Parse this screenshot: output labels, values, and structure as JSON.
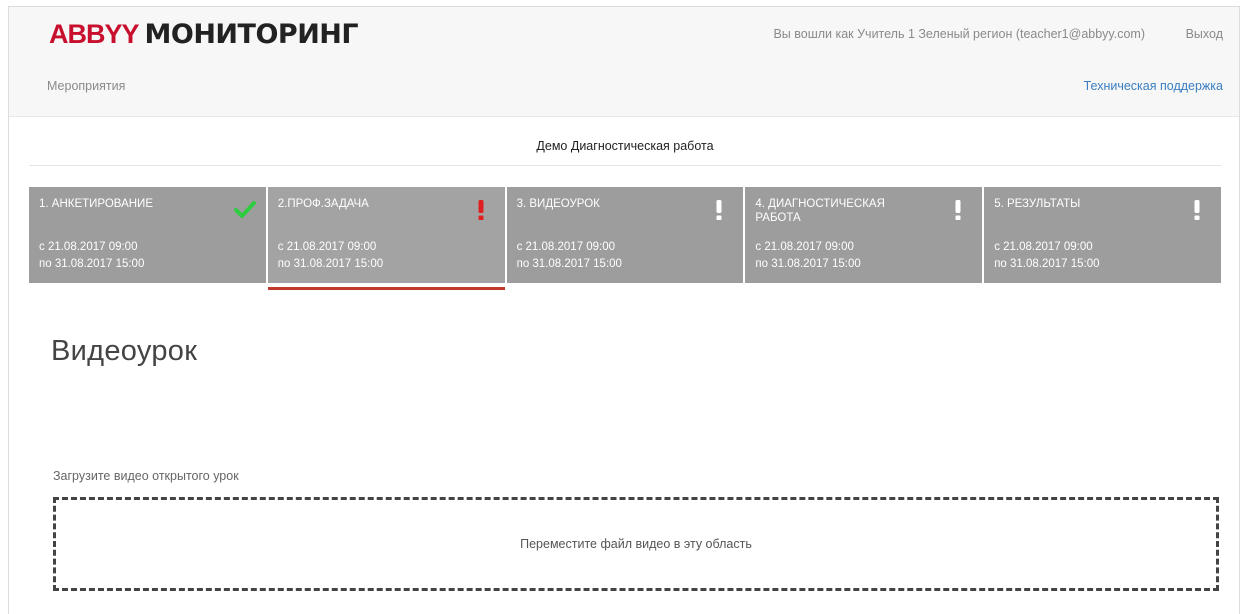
{
  "header": {
    "logo_brand": "ABBYY",
    "logo_product": "МОНИТОРИНГ",
    "user_info": "Вы вошли как Учитель 1 Зеленый регион (teacher1@abbyy.com)",
    "logout_label": "Выход",
    "menu_events": "Мероприятия",
    "support_label": "Техническая поддержка"
  },
  "event": {
    "title": "Демо Диагностическая работа"
  },
  "steps": [
    {
      "title": "1. АНКЕТИРОВАНИЕ",
      "from": "с 21.08.2017 09:00",
      "to": "по 31.08.2017 15:00",
      "status_icon": "check-icon",
      "status_color": "#2ecc40"
    },
    {
      "title": "2.ПРОФ.ЗАДАЧА",
      "from": "с 21.08.2017 09:00",
      "to": "по 31.08.2017 15:00",
      "status_icon": "exclamation-icon",
      "status_color": "#e02020"
    },
    {
      "title": "3. ВИДЕОУРОК",
      "from": "с 21.08.2017 09:00",
      "to": "по 31.08.2017 15:00",
      "status_icon": "exclamation-icon",
      "status_color": "#ffffff"
    },
    {
      "title": "4. ДИАГНОСТИЧЕСКАЯ РАБОТА",
      "from": "с 21.08.2017 09:00",
      "to": "по 31.08.2017 15:00",
      "status_icon": "exclamation-icon",
      "status_color": "#ffffff"
    },
    {
      "title": "5. РЕЗУЛЬТАТЫ",
      "from": "с 21.08.2017 09:00",
      "to": "по 31.08.2017 15:00",
      "status_icon": "exclamation-icon",
      "status_color": "#ffffff"
    }
  ],
  "main": {
    "heading": "Видеоурок",
    "upload_label": "Загрузите видео открытого урок",
    "dropzone_text": "Переместите файл видео в эту область"
  },
  "colors": {
    "brand_red": "#c8102e",
    "step_bg": "#9d9d9d",
    "active_underline": "#c0392b",
    "link_blue": "#3a7fc1"
  }
}
